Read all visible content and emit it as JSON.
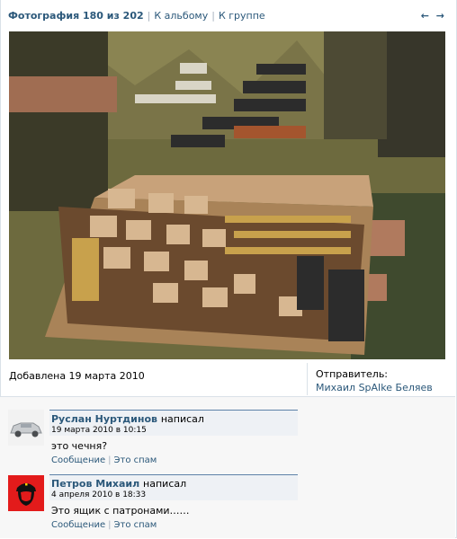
{
  "header": {
    "title": "Фотография 180 из 202",
    "album_link": "К альбому",
    "group_link": "К группе",
    "nav_arrows": "← →"
  },
  "photo": {
    "icon": "photo-image"
  },
  "meta": {
    "added": "Добавлена 19 марта 2010",
    "sender_label": "Отправитель:",
    "sender_name": "Михаил SpAIke Беляев"
  },
  "comments": [
    {
      "author": "Руслан Нуртдинов",
      "verb": "написал",
      "date": "19 марта 2010 в 10:15",
      "text": "это чечня?",
      "message_link": "Сообщение",
      "spam_link": "Это спам"
    },
    {
      "author": "Петров Михаил",
      "verb": "написал",
      "date": "4 апреля 2010 в 18:33",
      "text": "Это ящик с патронами……",
      "message_link": "Сообщение",
      "spam_link": "Это спам"
    }
  ],
  "colors": {
    "link": "#2b587a",
    "comment_header_bg": "#eef1f5",
    "comment_header_border": "#5e82a8"
  }
}
